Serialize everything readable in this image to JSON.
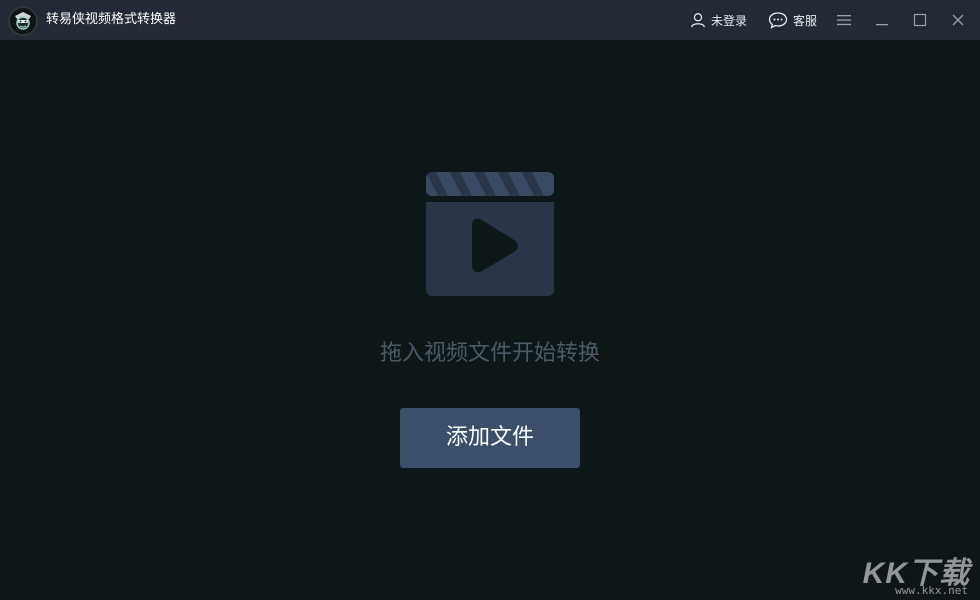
{
  "app": {
    "title": "转易侠视频格式转换器",
    "logo_icon": "masked-hero-logo"
  },
  "titlebar": {
    "login_label": "未登录",
    "login_icon": "user-icon",
    "service_label": "客服",
    "service_icon": "chat-bubble-icon",
    "menu_icon": "hamburger-menu-icon",
    "minimize_icon": "minimize-icon",
    "maximize_icon": "maximize-icon",
    "close_icon": "close-icon"
  },
  "main": {
    "placeholder_icon": "video-clapperboard-icon",
    "drop_hint": "拖入视频文件开始转换",
    "add_button_label": "添加文件"
  },
  "watermark": {
    "main": "KK下载",
    "sub": "www.kkx.net"
  },
  "colors": {
    "titlebar_bg": "#232a35",
    "body_bg": "#0e1718",
    "button_bg": "#3b4f6c",
    "hint_text": "#4e5966",
    "icon_fill": "#2a3647"
  }
}
